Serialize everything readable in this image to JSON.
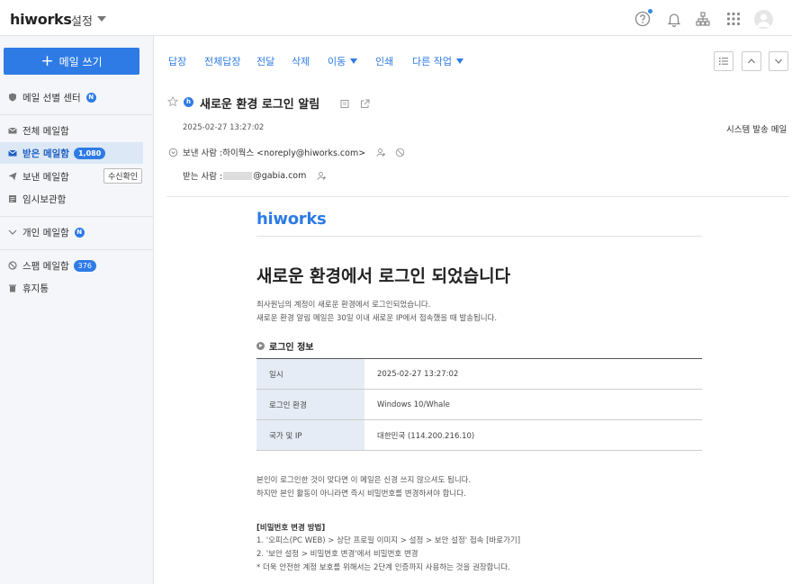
{
  "topbar": {
    "logo": "hiworks",
    "app_name": "설정"
  },
  "sidebar": {
    "compose_label": "메일 쓰기",
    "items": [
      {
        "label": "메일 선별 센터",
        "badge": "N"
      },
      {
        "label": "전체 메일함"
      },
      {
        "label": "받은 메일함",
        "badge": "1,080"
      },
      {
        "label": "보낸 메일함",
        "button": "수신확인"
      },
      {
        "label": "임시보관함"
      },
      {
        "label": "개인 메일함",
        "badge": "N"
      },
      {
        "label": "스팸 메일함",
        "badge": "376"
      },
      {
        "label": "휴지통"
      }
    ]
  },
  "toolbar": {
    "reply": "답장",
    "reply_all": "전체답장",
    "forward": "전달",
    "delete": "삭제",
    "move": "이동",
    "print": "인쇄",
    "other": "다른 작업"
  },
  "message": {
    "subject": "새로운 환경 로그인 알림",
    "sender_badge": "h",
    "date": "2025-02-27 13:27:02",
    "system_label": "시스템 발송 메일",
    "from_prefix": "보낸 사람 : ",
    "from_value": "하이웍스 <noreply@hiworks.com>",
    "to_prefix": "받는 사람 : ",
    "to_domain": "@gabia.com"
  },
  "email_body": {
    "logo": "hiworks",
    "title": "새로운 환경에서 로그인 되었습니다",
    "intro_1": "최사원님의 계정이 새로운 환경에서 로그인되었습니다.",
    "intro_2": "새로운 환경 알림 메일은 30일 이내 새로운 IP에서 접속했을 때 발송됩니다.",
    "section_title": "로그인 정보",
    "rows": [
      {
        "key": "일시",
        "value": "2025-02-27 13:27:02"
      },
      {
        "key": "로그인 환경",
        "value": "Windows 10/Whale"
      },
      {
        "key": "국가 및 IP",
        "value": "대한민국 (114.200.216.10)"
      }
    ],
    "note_1": "본인이 로그인한 것이 맞다면 이 메일은 신경 쓰지 않으셔도 됩니다.",
    "note_2": "하지만 본인 활동이 아니라면 즉시 비밀번호를 변경하셔야 합니다.",
    "pw_title": "[비밀번호 변경 방법]",
    "pw_step_1": "1. '오피스(PC WEB) > 상단 프로필 이미지 > 설정 > 보안 설정' 접속 [바로가기]",
    "pw_step_2": "2. '보안 설정 > 비밀번호 변경'에서 비밀번호 변경",
    "pw_note": "* 더욱 안전한 계정 보호를 위해서는 2단계 인증까지 사용하는 것을 권장합니다."
  },
  "colors": {
    "accent": "#2e7be6",
    "sidebar_bg": "#f4f6f9",
    "active_bg": "#dde8f6"
  }
}
